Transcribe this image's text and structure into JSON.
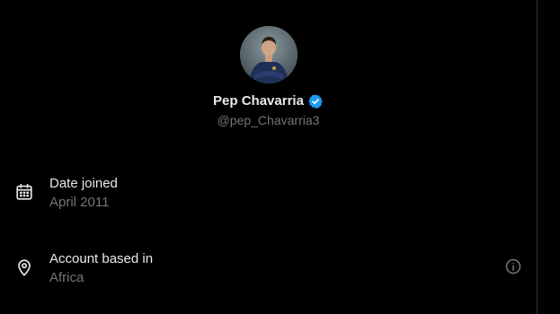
{
  "profile": {
    "display_name": "Pep Chavarria",
    "handle": "@pep_Chavarria3",
    "verified": true
  },
  "details": {
    "date_joined": {
      "label": "Date joined",
      "value": "April 2011",
      "icon": "calendar-icon"
    },
    "account_based_in": {
      "label": "Account based in",
      "value": "Africa",
      "icon": "location-pin-icon",
      "action_icon": "info-icon"
    }
  },
  "colors": {
    "background": "#000000",
    "primary_text": "#e7e9ea",
    "secondary_text": "#71767b",
    "verified_badge": "#1d9bf0",
    "divider": "#2f3336"
  }
}
